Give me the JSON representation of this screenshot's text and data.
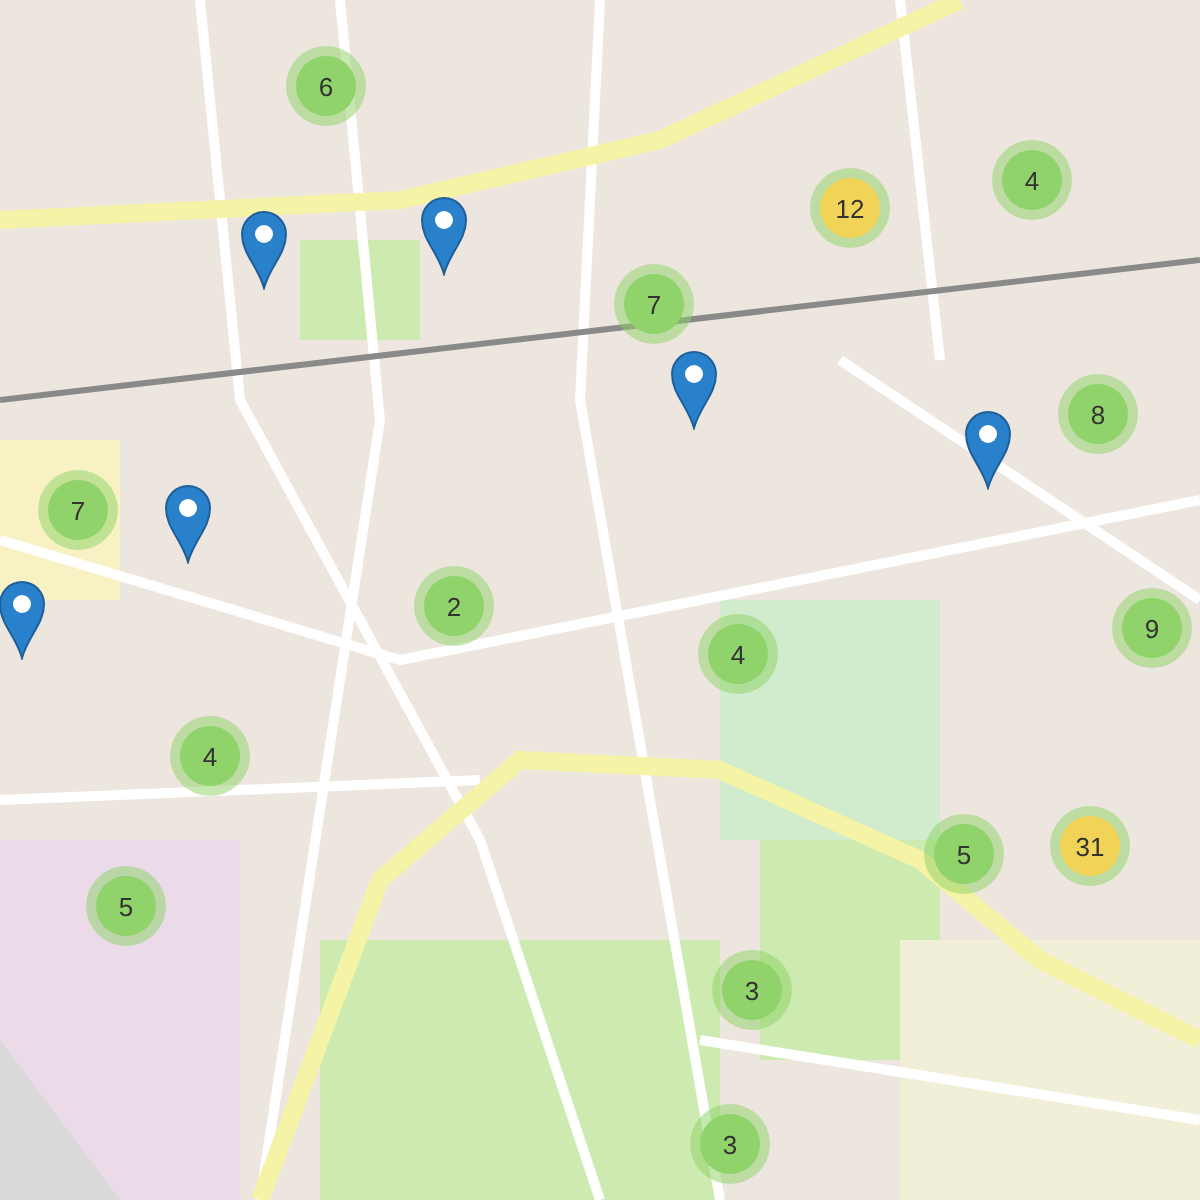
{
  "map": {
    "clusters": [
      {
        "count": "6",
        "color": "#8fd36a"
      },
      {
        "count": "4",
        "color": "#8fd36a"
      },
      {
        "count": "12",
        "color": "#f1d357"
      },
      {
        "count": "7",
        "color": "#8fd36a"
      },
      {
        "count": "8",
        "color": "#8fd36a"
      },
      {
        "count": "7",
        "color": "#8fd36a"
      },
      {
        "count": "2",
        "color": "#8fd36a"
      },
      {
        "count": "9",
        "color": "#8fd36a"
      },
      {
        "count": "4",
        "color": "#8fd36a"
      },
      {
        "count": "4",
        "color": "#8fd36a"
      },
      {
        "count": "5",
        "color": "#8fd36a"
      },
      {
        "count": "31",
        "color": "#f1d357"
      },
      {
        "count": "5",
        "color": "#8fd36a"
      },
      {
        "count": "3",
        "color": "#8fd36a"
      },
      {
        "count": "3",
        "color": "#8fd36a"
      }
    ]
  }
}
